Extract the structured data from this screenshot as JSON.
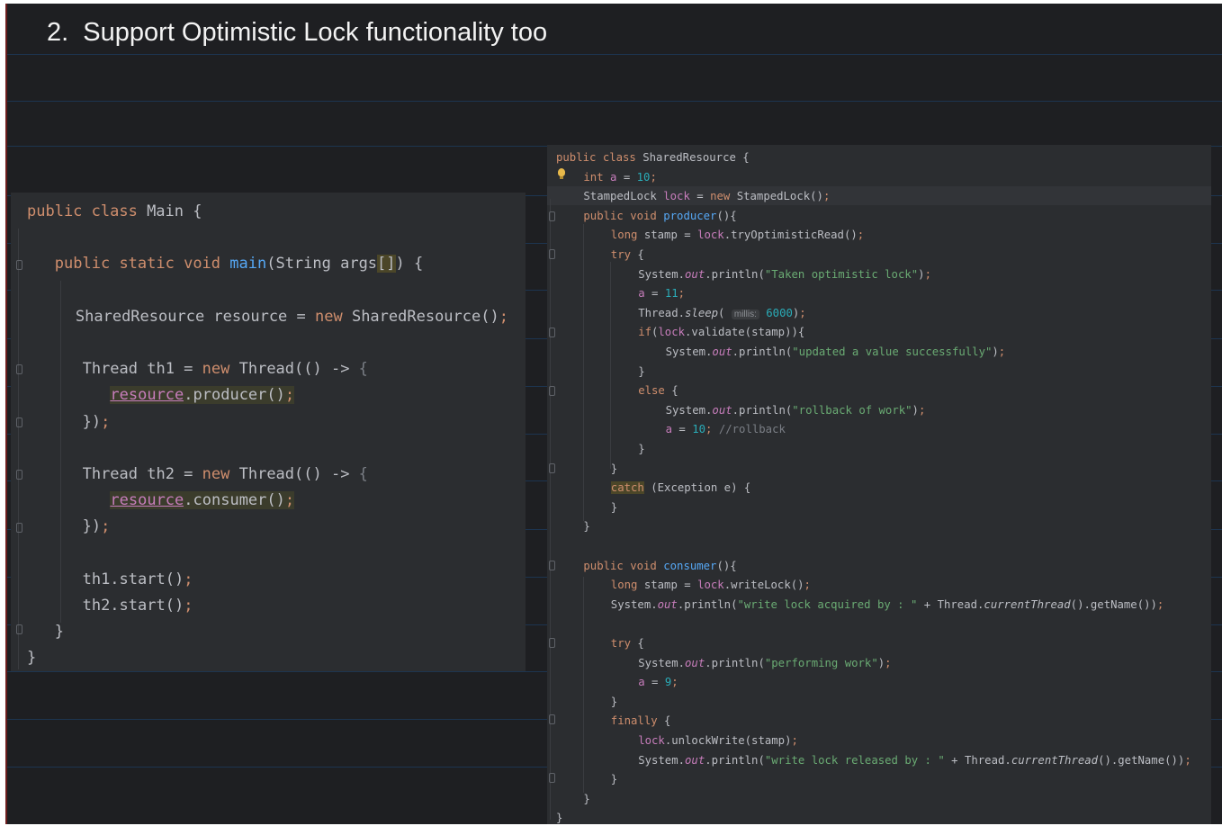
{
  "slide": {
    "title": "2.  Support Optimistic Lock functionality too"
  },
  "left_panel": {
    "lines": [
      {
        "indent": 0,
        "tokens": [
          {
            "t": "public class ",
            "c": "kw"
          },
          {
            "t": "Main {",
            "c": "df"
          }
        ]
      },
      {
        "indent": 0,
        "tokens": []
      },
      {
        "indent": 4,
        "tokens": [
          {
            "t": "public static void ",
            "c": "kw"
          },
          {
            "t": "main",
            "c": "fn"
          },
          {
            "t": "(String args",
            "c": "df"
          },
          {
            "t": "[]",
            "c": "df",
            "h": "box"
          },
          {
            "t": ") {",
            "c": "df"
          }
        ]
      },
      {
        "indent": 0,
        "tokens": []
      },
      {
        "indent": 7,
        "tokens": [
          {
            "t": "SharedResource resource = ",
            "c": "df"
          },
          {
            "t": "new ",
            "c": "kw"
          },
          {
            "t": "SharedResource()",
            "c": "df"
          },
          {
            "t": ";",
            "c": "kw"
          }
        ]
      },
      {
        "indent": 0,
        "tokens": []
      },
      {
        "indent": 8,
        "tokens": [
          {
            "t": "Thread th1 = ",
            "c": "df"
          },
          {
            "t": "new ",
            "c": "kw"
          },
          {
            "t": "Thread(() -> ",
            "c": "df"
          },
          {
            "t": "{",
            "c": "cm"
          }
        ]
      },
      {
        "indent": 12,
        "tokens": [
          {
            "t": "resource",
            "c": "fd",
            "u": true,
            "h": "bg"
          },
          {
            "t": ".producer()",
            "c": "df",
            "h": "bg"
          },
          {
            "t": ";",
            "c": "kw",
            "h": "bg"
          }
        ]
      },
      {
        "indent": 8,
        "tokens": [
          {
            "t": "})",
            "c": "df"
          },
          {
            "t": ";",
            "c": "kw"
          }
        ]
      },
      {
        "indent": 0,
        "tokens": []
      },
      {
        "indent": 8,
        "tokens": [
          {
            "t": "Thread th2 = ",
            "c": "df"
          },
          {
            "t": "new ",
            "c": "kw"
          },
          {
            "t": "Thread(() -> ",
            "c": "df"
          },
          {
            "t": "{",
            "c": "cm"
          }
        ]
      },
      {
        "indent": 12,
        "tokens": [
          {
            "t": "resource",
            "c": "fd",
            "u": true,
            "h": "bg"
          },
          {
            "t": ".consumer()",
            "c": "df",
            "h": "bg"
          },
          {
            "t": ";",
            "c": "kw",
            "h": "bg"
          }
        ]
      },
      {
        "indent": 8,
        "tokens": [
          {
            "t": "})",
            "c": "df"
          },
          {
            "t": ";",
            "c": "kw"
          }
        ]
      },
      {
        "indent": 0,
        "tokens": []
      },
      {
        "indent": 8,
        "tokens": [
          {
            "t": "th1.start()",
            "c": "df"
          },
          {
            "t": ";",
            "c": "kw"
          }
        ]
      },
      {
        "indent": 8,
        "tokens": [
          {
            "t": "th2.start()",
            "c": "df"
          },
          {
            "t": ";",
            "c": "kw"
          }
        ]
      },
      {
        "indent": 4,
        "tokens": [
          {
            "t": "}",
            "c": "df"
          }
        ]
      },
      {
        "indent": 0,
        "tokens": [
          {
            "t": "}",
            "c": "df"
          }
        ]
      }
    ]
  },
  "right_panel": {
    "lines": [
      {
        "indent": 0,
        "tokens": [
          {
            "t": "public class ",
            "c": "kw"
          },
          {
            "t": "SharedResource {",
            "c": "df"
          }
        ]
      },
      {
        "indent": 4,
        "tokens": [
          {
            "t": "int ",
            "c": "kw"
          },
          {
            "t": "a",
            "c": "fd"
          },
          {
            "t": " = ",
            "c": "df"
          },
          {
            "t": "10",
            "c": "nm"
          },
          {
            "t": ";",
            "c": "kw"
          }
        ]
      },
      {
        "indent": 4,
        "tokens": [
          {
            "t": "StampedLock ",
            "c": "df"
          },
          {
            "t": "lock",
            "c": "fd"
          },
          {
            "t": " = ",
            "c": "df"
          },
          {
            "t": "new ",
            "c": "kw"
          },
          {
            "t": "StampedLock()",
            "c": "df"
          },
          {
            "t": ";",
            "c": "kw"
          }
        ]
      },
      {
        "indent": 4,
        "tokens": [
          {
            "t": "public void ",
            "c": "kw"
          },
          {
            "t": "producer",
            "c": "fn"
          },
          {
            "t": "(){",
            "c": "df"
          }
        ]
      },
      {
        "indent": 8,
        "tokens": [
          {
            "t": "long ",
            "c": "kw"
          },
          {
            "t": "stamp = ",
            "c": "df"
          },
          {
            "t": "lock",
            "c": "fd"
          },
          {
            "t": ".tryOptimisticRead()",
            "c": "df"
          },
          {
            "t": ";",
            "c": "kw"
          }
        ]
      },
      {
        "indent": 8,
        "tokens": [
          {
            "t": "try ",
            "c": "kw"
          },
          {
            "t": "{",
            "c": "df"
          }
        ]
      },
      {
        "indent": 12,
        "tokens": [
          {
            "t": "System.",
            "c": "df"
          },
          {
            "t": "out",
            "c": "fd",
            "i": true
          },
          {
            "t": ".println(",
            "c": "df"
          },
          {
            "t": "\"Taken optimistic lock\"",
            "c": "st"
          },
          {
            "t": ")",
            "c": "df"
          },
          {
            "t": ";",
            "c": "kw"
          }
        ]
      },
      {
        "indent": 12,
        "tokens": [
          {
            "t": "a",
            "c": "fd"
          },
          {
            "t": " = ",
            "c": "df"
          },
          {
            "t": "11",
            "c": "nm"
          },
          {
            "t": ";",
            "c": "kw"
          }
        ]
      },
      {
        "indent": 12,
        "tokens": [
          {
            "t": "Thread.",
            "c": "df"
          },
          {
            "t": "sleep",
            "c": "df",
            "i": true
          },
          {
            "t": "( ",
            "c": "df"
          },
          {
            "t": "millis:",
            "c": "hint"
          },
          {
            "t": " ",
            "c": "df"
          },
          {
            "t": "6000",
            "c": "nm"
          },
          {
            "t": ")",
            "c": "df"
          },
          {
            "t": ";",
            "c": "kw"
          }
        ]
      },
      {
        "indent": 12,
        "tokens": [
          {
            "t": "if",
            "c": "kw"
          },
          {
            "t": "(",
            "c": "df"
          },
          {
            "t": "lock",
            "c": "fd"
          },
          {
            "t": ".validate(stamp)){",
            "c": "df"
          }
        ]
      },
      {
        "indent": 16,
        "tokens": [
          {
            "t": "System.",
            "c": "df"
          },
          {
            "t": "out",
            "c": "fd",
            "i": true
          },
          {
            "t": ".println(",
            "c": "df"
          },
          {
            "t": "\"updated a value successfully\"",
            "c": "st"
          },
          {
            "t": ")",
            "c": "df"
          },
          {
            "t": ";",
            "c": "kw"
          }
        ]
      },
      {
        "indent": 12,
        "tokens": [
          {
            "t": "}",
            "c": "df"
          }
        ]
      },
      {
        "indent": 12,
        "tokens": [
          {
            "t": "else ",
            "c": "kw"
          },
          {
            "t": "{",
            "c": "df"
          }
        ]
      },
      {
        "indent": 16,
        "tokens": [
          {
            "t": "System.",
            "c": "df"
          },
          {
            "t": "out",
            "c": "fd",
            "i": true
          },
          {
            "t": ".println(",
            "c": "df"
          },
          {
            "t": "\"rollback of work\"",
            "c": "st"
          },
          {
            "t": ")",
            "c": "df"
          },
          {
            "t": ";",
            "c": "kw"
          }
        ]
      },
      {
        "indent": 16,
        "tokens": [
          {
            "t": "a",
            "c": "fd"
          },
          {
            "t": " = ",
            "c": "df"
          },
          {
            "t": "10",
            "c": "nm"
          },
          {
            "t": "; ",
            "c": "kw"
          },
          {
            "t": "//rollback",
            "c": "cm"
          }
        ]
      },
      {
        "indent": 12,
        "tokens": [
          {
            "t": "}",
            "c": "df"
          }
        ]
      },
      {
        "indent": 8,
        "tokens": [
          {
            "t": "}",
            "c": "df"
          }
        ]
      },
      {
        "indent": 8,
        "tokens": [
          {
            "t": "catch",
            "c": "kw",
            "h": "box"
          },
          {
            "t": " (Exception e) {",
            "c": "df"
          }
        ]
      },
      {
        "indent": 8,
        "tokens": [
          {
            "t": "}",
            "c": "df"
          }
        ]
      },
      {
        "indent": 4,
        "tokens": [
          {
            "t": "}",
            "c": "df"
          }
        ]
      },
      {
        "indent": 0,
        "tokens": []
      },
      {
        "indent": 4,
        "tokens": [
          {
            "t": "public void ",
            "c": "kw"
          },
          {
            "t": "consumer",
            "c": "fn"
          },
          {
            "t": "(){",
            "c": "df"
          }
        ]
      },
      {
        "indent": 8,
        "tokens": [
          {
            "t": "long ",
            "c": "kw"
          },
          {
            "t": "stamp = ",
            "c": "df"
          },
          {
            "t": "lock",
            "c": "fd"
          },
          {
            "t": ".writeLock()",
            "c": "df"
          },
          {
            "t": ";",
            "c": "kw"
          }
        ]
      },
      {
        "indent": 8,
        "tokens": [
          {
            "t": "System.",
            "c": "df"
          },
          {
            "t": "out",
            "c": "fd",
            "i": true
          },
          {
            "t": ".println(",
            "c": "df"
          },
          {
            "t": "\"write lock acquired by : \"",
            "c": "st"
          },
          {
            "t": " + Thread.",
            "c": "df"
          },
          {
            "t": "currentThread",
            "c": "df",
            "i": true
          },
          {
            "t": "().getName())",
            "c": "df"
          },
          {
            "t": ";",
            "c": "kw"
          }
        ]
      },
      {
        "indent": 0,
        "tokens": []
      },
      {
        "indent": 8,
        "tokens": [
          {
            "t": "try ",
            "c": "kw"
          },
          {
            "t": "{",
            "c": "df"
          }
        ]
      },
      {
        "indent": 12,
        "tokens": [
          {
            "t": "System.",
            "c": "df"
          },
          {
            "t": "out",
            "c": "fd",
            "i": true
          },
          {
            "t": ".println(",
            "c": "df"
          },
          {
            "t": "\"performing work\"",
            "c": "st"
          },
          {
            "t": ")",
            "c": "df"
          },
          {
            "t": ";",
            "c": "kw"
          }
        ]
      },
      {
        "indent": 12,
        "tokens": [
          {
            "t": "a",
            "c": "fd"
          },
          {
            "t": " = ",
            "c": "df"
          },
          {
            "t": "9",
            "c": "nm"
          },
          {
            "t": ";",
            "c": "kw"
          }
        ]
      },
      {
        "indent": 8,
        "tokens": [
          {
            "t": "}",
            "c": "df"
          }
        ]
      },
      {
        "indent": 8,
        "tokens": [
          {
            "t": "finally ",
            "c": "kw"
          },
          {
            "t": "{",
            "c": "df"
          }
        ]
      },
      {
        "indent": 12,
        "tokens": [
          {
            "t": "lock",
            "c": "fd"
          },
          {
            "t": ".unlockWrite(stamp)",
            "c": "df"
          },
          {
            "t": ";",
            "c": "kw"
          }
        ]
      },
      {
        "indent": 12,
        "tokens": [
          {
            "t": "System.",
            "c": "df"
          },
          {
            "t": "out",
            "c": "fd",
            "i": true
          },
          {
            "t": ".println(",
            "c": "df"
          },
          {
            "t": "\"write lock released by : \"",
            "c": "st"
          },
          {
            "t": " + Thread.",
            "c": "df"
          },
          {
            "t": "currentThread",
            "c": "df",
            "i": true
          },
          {
            "t": "().getName())",
            "c": "df"
          },
          {
            "t": ";",
            "c": "kw"
          }
        ]
      },
      {
        "indent": 8,
        "tokens": [
          {
            "t": "}",
            "c": "df"
          }
        ]
      },
      {
        "indent": 4,
        "tokens": [
          {
            "t": "}",
            "c": "df"
          }
        ]
      },
      {
        "indent": 0,
        "tokens": [
          {
            "t": "}",
            "c": "df"
          }
        ]
      }
    ]
  },
  "colors": {
    "keyword": "#cf8e6d",
    "default": "#bcbec4",
    "function": "#56a8f5",
    "field": "#c77dbb",
    "string": "#6aab73",
    "number": "#2aacb8",
    "comment": "#7a7e85",
    "editor_background": "#2b2d30",
    "slide_background": "#1e1f22"
  },
  "icons": {
    "gutter_intention": "lightbulb-icon",
    "gutter_folds": "fold-marker-icon"
  }
}
